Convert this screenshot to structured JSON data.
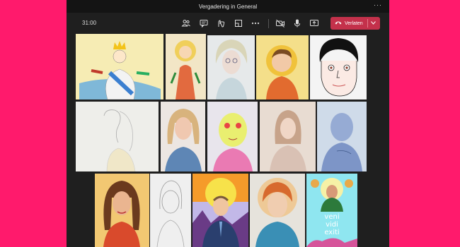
{
  "window": {
    "title": "Vergadering in General",
    "more_glyph": "···"
  },
  "toolbar": {
    "timer": "31:00",
    "icons": [
      "people-icon",
      "chat-icon",
      "reactions-icon",
      "rooms-icon",
      "more-actions-icon",
      "camera-icon",
      "microphone-icon",
      "share-screen-icon"
    ],
    "leave_label": "Verlaten"
  },
  "colors": {
    "background": "#ff1a6c",
    "window": "#1f1f1f",
    "titlebar": "#141414",
    "leave_button": "#c4314b"
  },
  "tiles": {
    "t13": {
      "line1": "veni",
      "line2": "vidi",
      "line3": "exiti"
    }
  }
}
